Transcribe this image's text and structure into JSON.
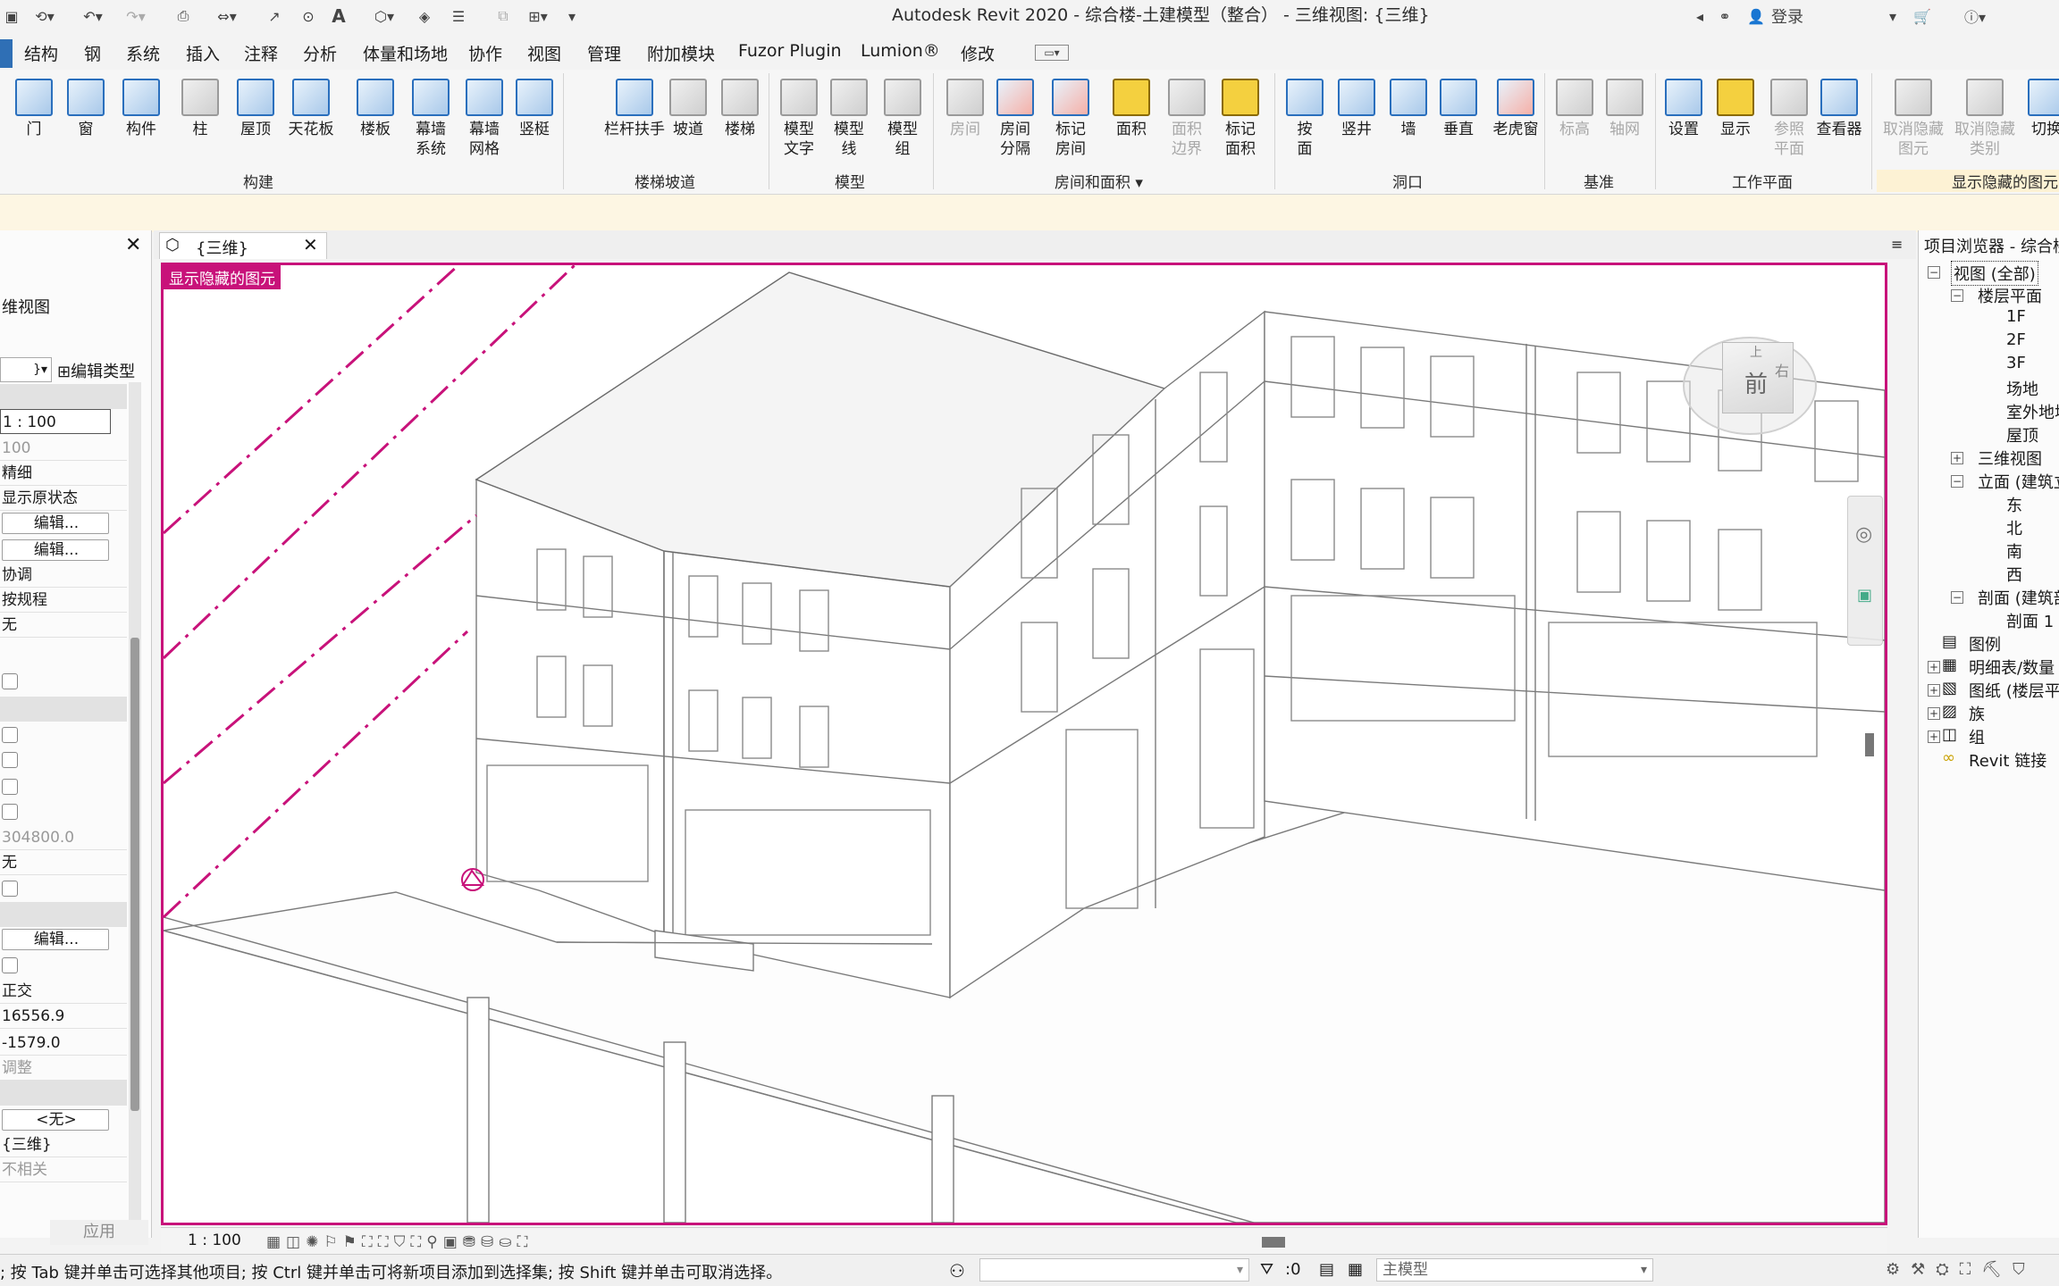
{
  "title": "Autodesk Revit 2020 - 综合楼-土建模型（整合） - 三维视图: {三维}",
  "user": {
    "login_label": "登录"
  },
  "menu": [
    "结构",
    "钢",
    "系统",
    "插入",
    "注释",
    "分析",
    "体量和场地",
    "协作",
    "视图",
    "管理",
    "附加模块",
    "Fuzor Plugin",
    "Lumion®",
    "修改"
  ],
  "ribbon": {
    "buttons": [
      "门",
      "窗",
      "构件",
      "柱",
      "屋顶",
      "天花板",
      "楼板",
      "幕墙\n系统",
      "幕墙\n网格",
      "竖梃",
      "栏杆扶手",
      "坡道",
      "楼梯",
      "模型\n文字",
      "模型\n线",
      "模型\n组",
      "房间",
      "房间\n分隔",
      "标记\n房间",
      "面积",
      "面积\n边界",
      "标记\n面积",
      "按\n面",
      "竖井",
      "墙",
      "垂直",
      "老虎窗",
      "标高",
      "轴网",
      "设置",
      "显示",
      "参照\n平面",
      "查看器",
      "取消隐藏\n图元",
      "取消隐藏\n类别",
      "切换"
    ],
    "groups": [
      "构建",
      "楼梯坡道",
      "模型",
      "房间和面积 ▾",
      "洞口",
      "基准",
      "工作平面",
      "显示隐藏的图元"
    ]
  },
  "properties": {
    "type_label": "维视图",
    "edit_type": "编辑类型",
    "rows": [
      "1 : 100",
      "100",
      "精细",
      "显示原状态",
      "编辑...",
      "编辑...",
      "协调",
      "按规程",
      "无",
      "304800.0",
      "无",
      "编辑...",
      "正交",
      "16556.9",
      "-1579.0",
      "调整",
      "<无>",
      "{三维}",
      "不相关"
    ],
    "apply_label": "应用"
  },
  "view_tab": {
    "label": "{三维}"
  },
  "viewport": {
    "hidden_label": "显示隐藏的图元",
    "viewcube": {
      "front": "前",
      "right": "右",
      "top": "上"
    }
  },
  "view_control": {
    "scale": "1 : 100"
  },
  "browser": {
    "title": "项目浏览器 - 综合楼",
    "items": [
      "视图 (全部)",
      "楼层平面",
      "1F",
      "2F",
      "3F",
      "场地",
      "室外地坪",
      "屋顶",
      "三维视图",
      "立面 (建筑立面)",
      "东",
      "北",
      "南",
      "西",
      "剖面 (建筑剖面)",
      "剖面 1",
      "图例",
      "明细表/数量",
      "图纸 (楼层平",
      "族",
      "组",
      "Revit 链接"
    ]
  },
  "status": {
    "message": "; 按 Tab 键并单击可选择其他项目; 按 Ctrl 键并单击可将新项目添加到选择集; 按 Shift 键并单击可取消选择。",
    "selection_count": ":0",
    "workset": "主模型"
  }
}
